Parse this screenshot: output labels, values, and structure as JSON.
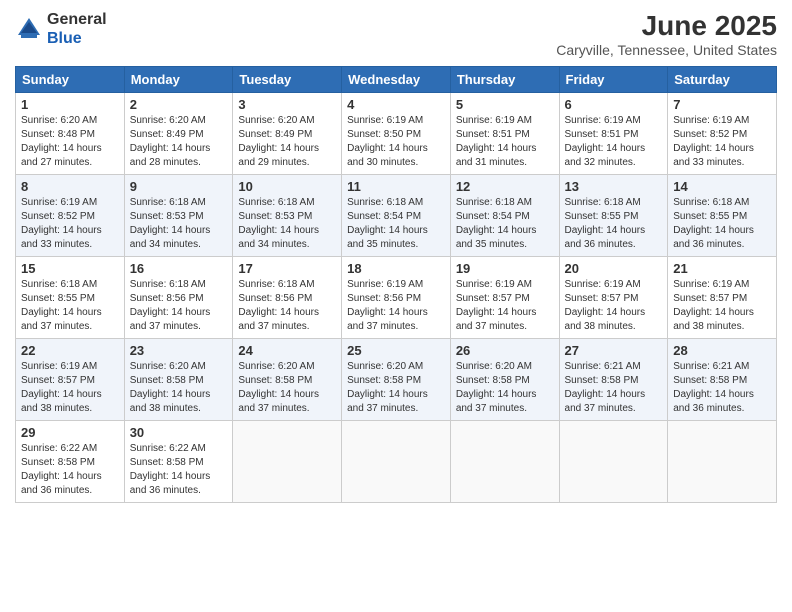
{
  "header": {
    "logo_line1": "General",
    "logo_line2": "Blue",
    "month_year": "June 2025",
    "location": "Caryville, Tennessee, United States"
  },
  "days_of_week": [
    "Sunday",
    "Monday",
    "Tuesday",
    "Wednesday",
    "Thursday",
    "Friday",
    "Saturday"
  ],
  "weeks": [
    [
      {
        "day": "1",
        "sunrise": "6:20 AM",
        "sunset": "8:48 PM",
        "daylight": "14 hours and 27 minutes."
      },
      {
        "day": "2",
        "sunrise": "6:20 AM",
        "sunset": "8:49 PM",
        "daylight": "14 hours and 28 minutes."
      },
      {
        "day": "3",
        "sunrise": "6:20 AM",
        "sunset": "8:49 PM",
        "daylight": "14 hours and 29 minutes."
      },
      {
        "day": "4",
        "sunrise": "6:19 AM",
        "sunset": "8:50 PM",
        "daylight": "14 hours and 30 minutes."
      },
      {
        "day": "5",
        "sunrise": "6:19 AM",
        "sunset": "8:51 PM",
        "daylight": "14 hours and 31 minutes."
      },
      {
        "day": "6",
        "sunrise": "6:19 AM",
        "sunset": "8:51 PM",
        "daylight": "14 hours and 32 minutes."
      },
      {
        "day": "7",
        "sunrise": "6:19 AM",
        "sunset": "8:52 PM",
        "daylight": "14 hours and 33 minutes."
      }
    ],
    [
      {
        "day": "8",
        "sunrise": "6:19 AM",
        "sunset": "8:52 PM",
        "daylight": "14 hours and 33 minutes."
      },
      {
        "day": "9",
        "sunrise": "6:18 AM",
        "sunset": "8:53 PM",
        "daylight": "14 hours and 34 minutes."
      },
      {
        "day": "10",
        "sunrise": "6:18 AM",
        "sunset": "8:53 PM",
        "daylight": "14 hours and 34 minutes."
      },
      {
        "day": "11",
        "sunrise": "6:18 AM",
        "sunset": "8:54 PM",
        "daylight": "14 hours and 35 minutes."
      },
      {
        "day": "12",
        "sunrise": "6:18 AM",
        "sunset": "8:54 PM",
        "daylight": "14 hours and 35 minutes."
      },
      {
        "day": "13",
        "sunrise": "6:18 AM",
        "sunset": "8:55 PM",
        "daylight": "14 hours and 36 minutes."
      },
      {
        "day": "14",
        "sunrise": "6:18 AM",
        "sunset": "8:55 PM",
        "daylight": "14 hours and 36 minutes."
      }
    ],
    [
      {
        "day": "15",
        "sunrise": "6:18 AM",
        "sunset": "8:55 PM",
        "daylight": "14 hours and 37 minutes."
      },
      {
        "day": "16",
        "sunrise": "6:18 AM",
        "sunset": "8:56 PM",
        "daylight": "14 hours and 37 minutes."
      },
      {
        "day": "17",
        "sunrise": "6:18 AM",
        "sunset": "8:56 PM",
        "daylight": "14 hours and 37 minutes."
      },
      {
        "day": "18",
        "sunrise": "6:19 AM",
        "sunset": "8:56 PM",
        "daylight": "14 hours and 37 minutes."
      },
      {
        "day": "19",
        "sunrise": "6:19 AM",
        "sunset": "8:57 PM",
        "daylight": "14 hours and 37 minutes."
      },
      {
        "day": "20",
        "sunrise": "6:19 AM",
        "sunset": "8:57 PM",
        "daylight": "14 hours and 38 minutes."
      },
      {
        "day": "21",
        "sunrise": "6:19 AM",
        "sunset": "8:57 PM",
        "daylight": "14 hours and 38 minutes."
      }
    ],
    [
      {
        "day": "22",
        "sunrise": "6:19 AM",
        "sunset": "8:57 PM",
        "daylight": "14 hours and 38 minutes."
      },
      {
        "day": "23",
        "sunrise": "6:20 AM",
        "sunset": "8:58 PM",
        "daylight": "14 hours and 38 minutes."
      },
      {
        "day": "24",
        "sunrise": "6:20 AM",
        "sunset": "8:58 PM",
        "daylight": "14 hours and 37 minutes."
      },
      {
        "day": "25",
        "sunrise": "6:20 AM",
        "sunset": "8:58 PM",
        "daylight": "14 hours and 37 minutes."
      },
      {
        "day": "26",
        "sunrise": "6:20 AM",
        "sunset": "8:58 PM",
        "daylight": "14 hours and 37 minutes."
      },
      {
        "day": "27",
        "sunrise": "6:21 AM",
        "sunset": "8:58 PM",
        "daylight": "14 hours and 37 minutes."
      },
      {
        "day": "28",
        "sunrise": "6:21 AM",
        "sunset": "8:58 PM",
        "daylight": "14 hours and 36 minutes."
      }
    ],
    [
      {
        "day": "29",
        "sunrise": "6:22 AM",
        "sunset": "8:58 PM",
        "daylight": "14 hours and 36 minutes."
      },
      {
        "day": "30",
        "sunrise": "6:22 AM",
        "sunset": "8:58 PM",
        "daylight": "14 hours and 36 minutes."
      },
      {
        "day": "",
        "sunrise": "",
        "sunset": "",
        "daylight": ""
      },
      {
        "day": "",
        "sunrise": "",
        "sunset": "",
        "daylight": ""
      },
      {
        "day": "",
        "sunrise": "",
        "sunset": "",
        "daylight": ""
      },
      {
        "day": "",
        "sunrise": "",
        "sunset": "",
        "daylight": ""
      },
      {
        "day": "",
        "sunrise": "",
        "sunset": "",
        "daylight": ""
      }
    ]
  ]
}
